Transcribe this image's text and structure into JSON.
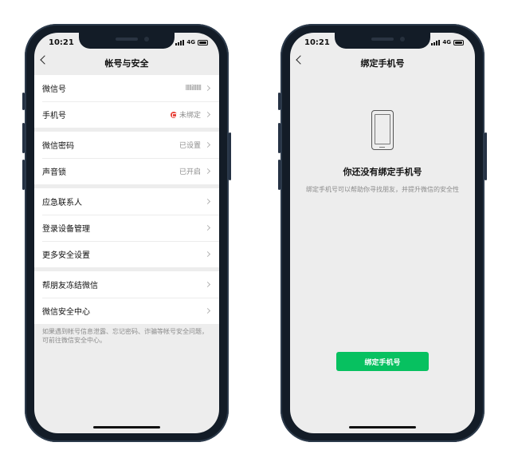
{
  "colors": {
    "accent": "#07c160",
    "warning": "#e8453c",
    "background": "#ededed",
    "phone_frame": "#131c27"
  },
  "left_phone": {
    "status": {
      "time": "10:21",
      "network": "4G"
    },
    "nav": {
      "title": "帐号与安全",
      "back_icon": "chevron-left-icon"
    },
    "groups": [
      {
        "rows": [
          {
            "label": "微信号",
            "value": "lllllilllllll"
          },
          {
            "label": "手机号",
            "value": "未绑定",
            "badge_icon": "lock-warning-icon"
          }
        ]
      },
      {
        "rows": [
          {
            "label": "微信密码",
            "value": "已设置"
          },
          {
            "label": "声音锁",
            "value": "已开启"
          }
        ]
      },
      {
        "rows": [
          {
            "label": "应急联系人",
            "value": ""
          },
          {
            "label": "登录设备管理",
            "value": ""
          },
          {
            "label": "更多安全设置",
            "value": ""
          }
        ]
      },
      {
        "rows": [
          {
            "label": "帮朋友冻结微信",
            "value": ""
          },
          {
            "label": "微信安全中心",
            "value": ""
          }
        ]
      }
    ],
    "footnote": "如果遇到帐号信息泄露、忘记密码、诈骗等帐号安全问题，可前往微信安全中心。"
  },
  "right_phone": {
    "status": {
      "time": "10:21",
      "network": "4G"
    },
    "nav": {
      "title": "绑定手机号",
      "back_icon": "chevron-left-icon"
    },
    "illustration_icon": "smartphone-icon",
    "empty_title": "你还没有绑定手机号",
    "empty_desc": "绑定手机号可以帮助你寻找朋友，并提升微信的安全性",
    "button_label": "绑定手机号"
  }
}
